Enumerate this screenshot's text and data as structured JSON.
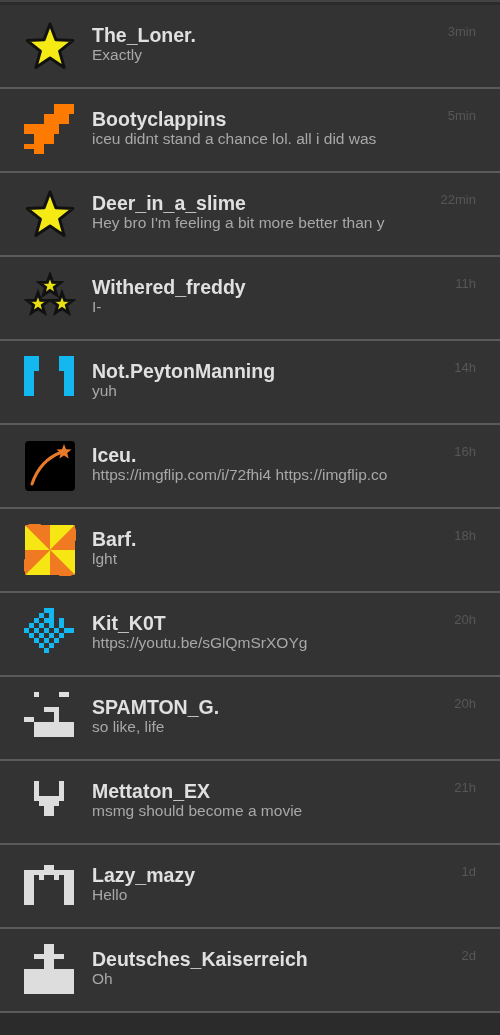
{
  "conversations": [
    {
      "kind": "star",
      "name": "The_Loner.",
      "message": "Exactly",
      "time": "3min"
    },
    {
      "kind": "orange-steps",
      "name": "Bootyclappins",
      "message": "iceu didnt stand a chance lol. all i did was",
      "time": "5min"
    },
    {
      "kind": "star",
      "name": "Deer_in_a_slime",
      "message": "Hey bro I'm feeling a bit more better than y",
      "time": "22min"
    },
    {
      "kind": "three-stars",
      "name": "Withered_freddy",
      "message": "I-",
      "time": "11h"
    },
    {
      "kind": "blue-bars",
      "name": "Not.PeytonManning",
      "message": "yuh",
      "time": "14h"
    },
    {
      "kind": "shooting-star",
      "name": "Iceu.",
      "message": "https://imgflip.com/i/72fhi4 https://imgflip.co",
      "time": "16h"
    },
    {
      "kind": "pinwheel",
      "name": "Barf.",
      "message": "lght",
      "time": "18h"
    },
    {
      "kind": "diamond",
      "name": "Kit_K0T",
      "message": "https://youtu.be/sGlQmSrXOYg",
      "time": "20h"
    },
    {
      "kind": "grey-face",
      "name": "SPAMTON_G.",
      "message": "so like, life",
      "time": "20h"
    },
    {
      "kind": "grey-fork",
      "name": "Mettaton_EX",
      "message": "msmg should become a movie",
      "time": "21h"
    },
    {
      "kind": "grey-m",
      "name": "Lazy_mazy",
      "message": "Hello",
      "time": "1d"
    },
    {
      "kind": "grey-cross",
      "name": "Deutsches_Kaiserreich",
      "message": "Oh",
      "time": "2d"
    }
  ]
}
